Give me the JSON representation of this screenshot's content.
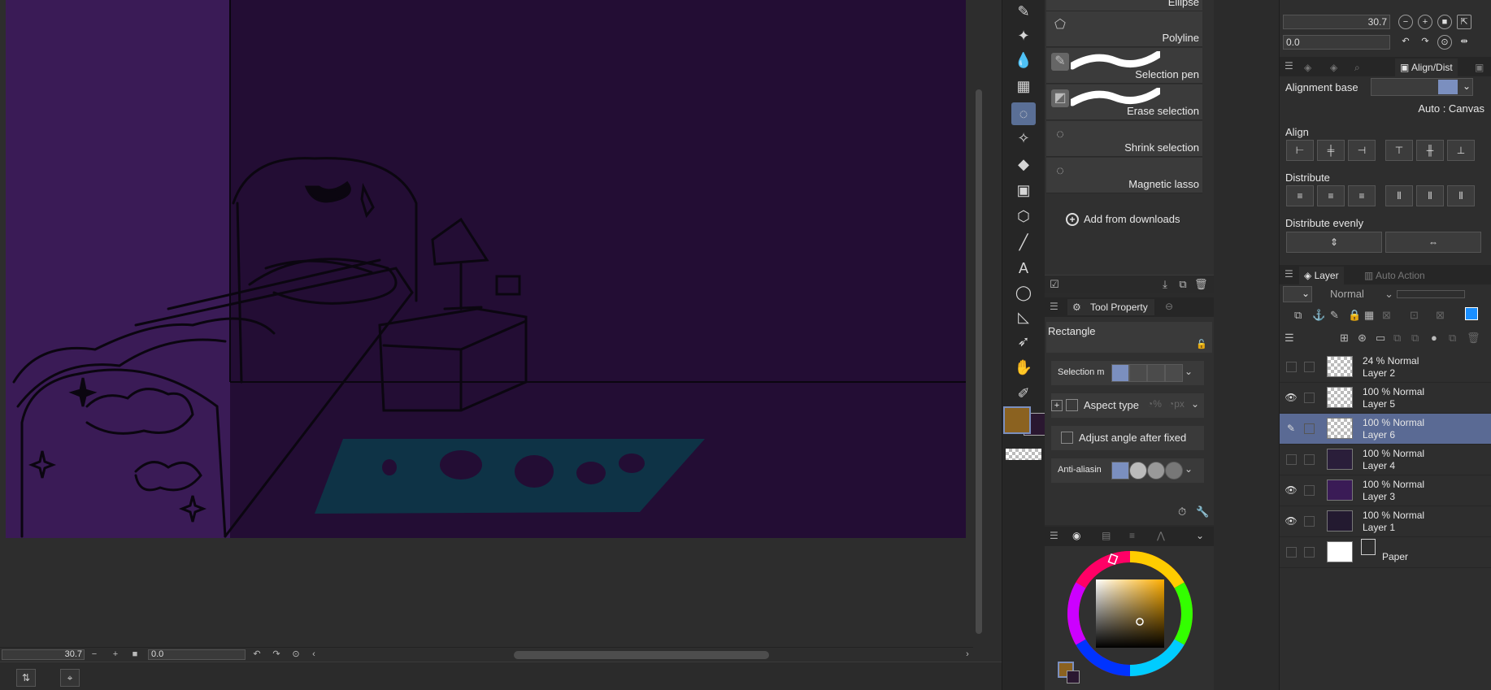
{
  "canvas": {
    "zoom_value": "30.7",
    "rotate_value": "0.0",
    "colors": {
      "background": "#230d34",
      "left_wall": "#3a1b56",
      "line": "#0b0610",
      "rug": "#0e3346"
    }
  },
  "subtool": {
    "items": [
      {
        "label": "Ellipse",
        "icon": "ellipse-icon"
      },
      {
        "label": "Polyline",
        "icon": "polyline-icon"
      },
      {
        "label": "Selection pen",
        "icon": "selection-pen-icon"
      },
      {
        "label": "Erase selection",
        "icon": "eraser-icon"
      },
      {
        "label": "Shrink selection",
        "icon": "lasso-icon"
      },
      {
        "label": "Magnetic lasso",
        "icon": "lasso-icon"
      }
    ],
    "add_from_downloads": "Add from downloads"
  },
  "tool_property": {
    "tab_label": "Tool Property",
    "tool_name": "Rectangle",
    "selection_mode_label": "Selection m",
    "aspect_type_label": "Aspect type",
    "adjust_angle_label": "Adjust angle after fixed",
    "anti_alias_label": "Anti-aliasin"
  },
  "colors": {
    "main_color": "#8b6220",
    "sub_color": "#2a1730",
    "accent": "#5a6a94"
  },
  "navigator": {
    "zoom_value": "30.7",
    "rotate_value": "0.0"
  },
  "align_panel": {
    "tab_label": "Align/Dist",
    "alignment_base_label": "Alignment base",
    "auto_canvas_label": "Auto : Canvas",
    "align_label": "Align",
    "distribute_label": "Distribute",
    "distribute_evenly_label": "Distribute evenly"
  },
  "layer_panel": {
    "tab_layer": "Layer",
    "tab_auto_action": "Auto Action",
    "blend_mode": "Normal",
    "layers": [
      {
        "line1": "24 % Normal",
        "line2": "Layer 2",
        "visible": false,
        "selected": false,
        "thumb": "checker"
      },
      {
        "line1": "100 % Normal",
        "line2": "Layer 5",
        "visible": true,
        "selected": false,
        "thumb": "sketch"
      },
      {
        "line1": "100 % Normal",
        "line2": "Layer 6",
        "visible": false,
        "selected": true,
        "thumb": "checker"
      },
      {
        "line1": "100 % Normal",
        "line2": "Layer 4",
        "visible": false,
        "selected": false,
        "thumb": "dark-sketch"
      },
      {
        "line1": "100 % Normal",
        "line2": "Layer 3",
        "visible": true,
        "selected": false,
        "thumb": "purple"
      },
      {
        "line1": "100 % Normal",
        "line2": "Layer 1",
        "visible": true,
        "selected": false,
        "thumb": "dark"
      },
      {
        "line1": "",
        "line2": "Paper",
        "visible": false,
        "selected": false,
        "thumb": "white"
      }
    ]
  }
}
